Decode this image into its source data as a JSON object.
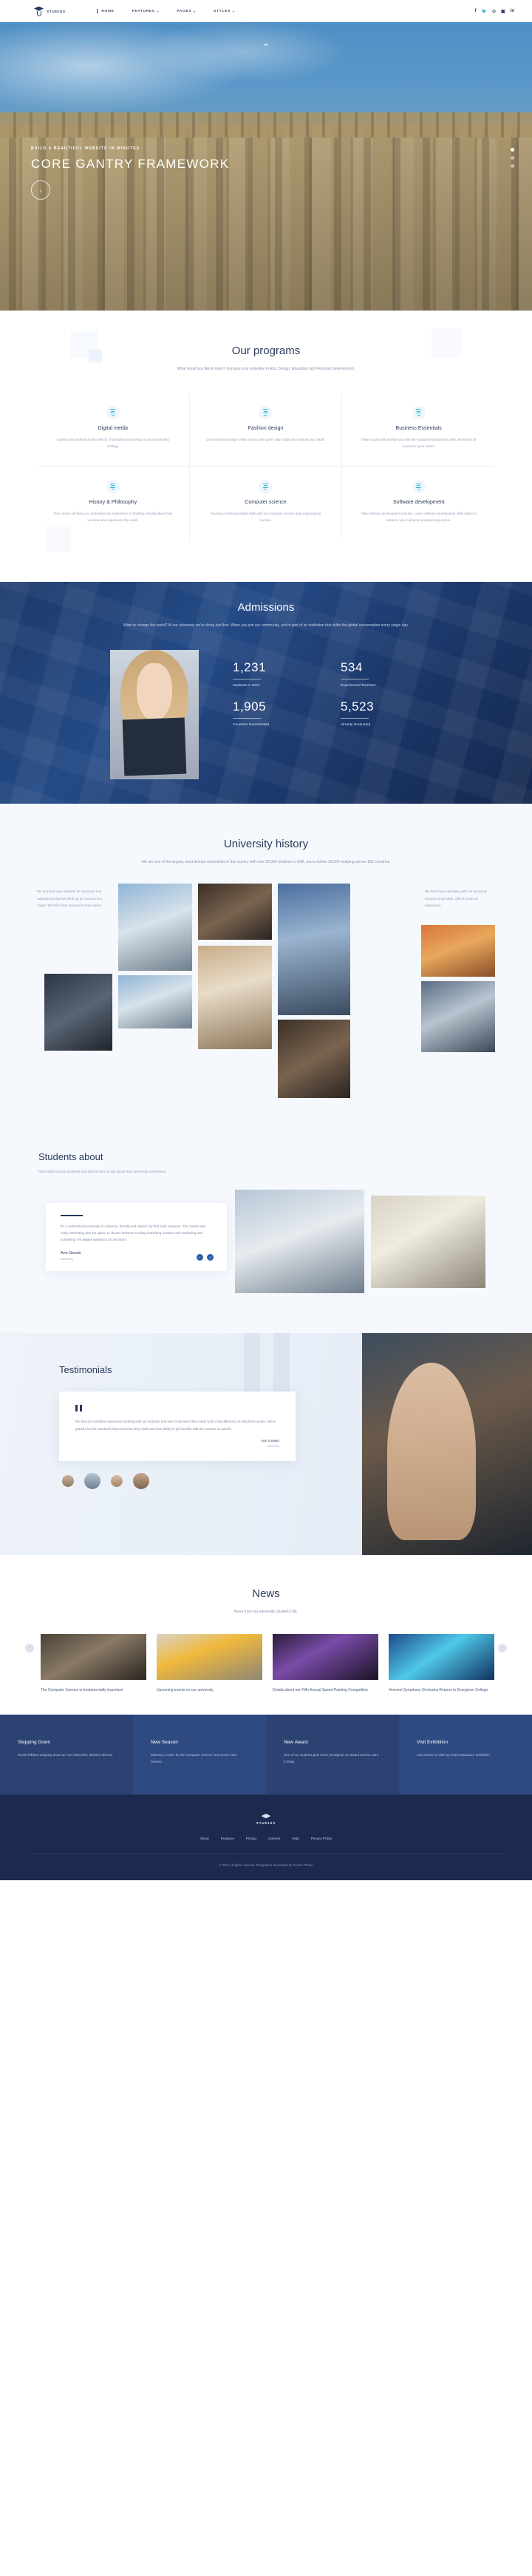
{
  "header": {
    "logo_text": "STUDIUS",
    "nav": [
      {
        "label": "HOME",
        "caret": "",
        "active": true
      },
      {
        "label": "FEATURES",
        "caret": "▾",
        "active": false
      },
      {
        "label": "PAGES",
        "caret": "▾",
        "active": false
      },
      {
        "label": "STYLES",
        "caret": "▾",
        "active": false
      }
    ],
    "social": [
      "f",
      "🐦",
      "⊙",
      "▣",
      "in"
    ]
  },
  "hero": {
    "kicker": "BUILD A BEAUTIFUL WEBSITE IN MINUTES.",
    "title": "CORE GANTRY FRAMEWORK",
    "button_icon": "↓",
    "top_arrow": "⌃"
  },
  "programs": {
    "title": "Our programs",
    "subtitle": "What would you like to learn? Increase your expertise in Arts, Design, Education and Personal Development.",
    "cards": [
      {
        "title": "Digital media",
        "desc": "Explore and understand the effects of disruptive technology on your marketing strategy."
      },
      {
        "title": "Fashion design",
        "desc": "Learn Fashion Design online at your own pace. Start today and improve your skills."
      },
      {
        "title": "Business Essentials",
        "desc": "These course will provide you with the fundamental business skills necessary for success in your career."
      },
      {
        "title": "History & Philosophy",
        "desc": "This course will help you understand the importance of thinking critically about how we know and experience the world."
      },
      {
        "title": "Computer science",
        "desc": "Develop in-demand digital skills with our computer science and programming courses."
      },
      {
        "title": "Software development",
        "desc": "Take software development courses. Learn software development skills online to advance your computer programming career."
      }
    ]
  },
  "admissions": {
    "title": "Admissions",
    "subtitle": "Want to change the world? At our university we're doing just that. When you join our community, you're part of an institution that shifts the global conversation every single day.",
    "stats": [
      {
        "number": "1,231",
        "label": "Students In 2022"
      },
      {
        "number": "534",
        "label": "Experienced Teachers"
      },
      {
        "number": "1,905",
        "label": "Countries Represented"
      },
      {
        "number": "5,523",
        "label": "Already Graduated"
      }
    ]
  },
  "history": {
    "title": "University history",
    "subtitle": "We are one of the largest, most diverse universities in the country with over 20,000 students in USA, and a further 30,000 studying across 180 countries.",
    "left_text": "We don't just give students an education and experiences that set them up for success in a career. We help them succeed in their career.",
    "right_text": "We have been operating with our university success since 1988, with 30 years of experience."
  },
  "students_about": {
    "title": "Students about",
    "subtitle": "Read what current students and alumni have to say about their university experience.",
    "quote": "It's a multicultural university in a diverse, friendly and vibrant city that suits everyone. The course was really interesting with the option to choose between exciting marketing modules and marketing was something I've always wanted to do and learn.",
    "name": "Ann Gossio",
    "role": "Marketing",
    "prev_icon": "‹",
    "next_icon": "›"
  },
  "testimonials": {
    "title": "Testimonials",
    "quote": "We had an incredible experience working with our students and were impressed they made such a big difference in only three weeks. We're grateful for the wonderful improvements they made and their ability to get familiar with the courses so quickly.",
    "name": "Ann Gossio",
    "role": "Marketing"
  },
  "news": {
    "title": "News",
    "subtitle": "News from our university, student's life.",
    "prev_icon": "‹",
    "next_icon": "›",
    "cards": [
      {
        "title": "The Computer Science is fundamentally important"
      },
      {
        "title": "Upcoming events on our university"
      },
      {
        "title": "Details about our Fifth Annual Speed Painting Competition"
      },
      {
        "title": "Vermont Symphony Orchestra Returns to Evergreen College"
      }
    ]
  },
  "promo": [
    {
      "title": "Stepping Down",
      "text": "David Williams stepping down as vice chancellor, athletics director"
    },
    {
      "title": "New Season",
      "text": "Mahoney Center for the Computer Science Announces New Season"
    },
    {
      "title": "New Award",
      "text": "One of our students gets some prestigious art award and we want to brag."
    },
    {
      "title": "Visit Exhibition",
      "text": "Last chance to visit our 2018 Graduates' Exhibition"
    }
  ],
  "footer": {
    "logo_text": "STUDIUS",
    "links": [
      "About",
      "Features",
      "Pricing",
      "Careers",
      "Help",
      "Privacy Policy"
    ],
    "copyright": "© 2022 All rights reserved. Designed & Developed by Rocket Theme"
  }
}
